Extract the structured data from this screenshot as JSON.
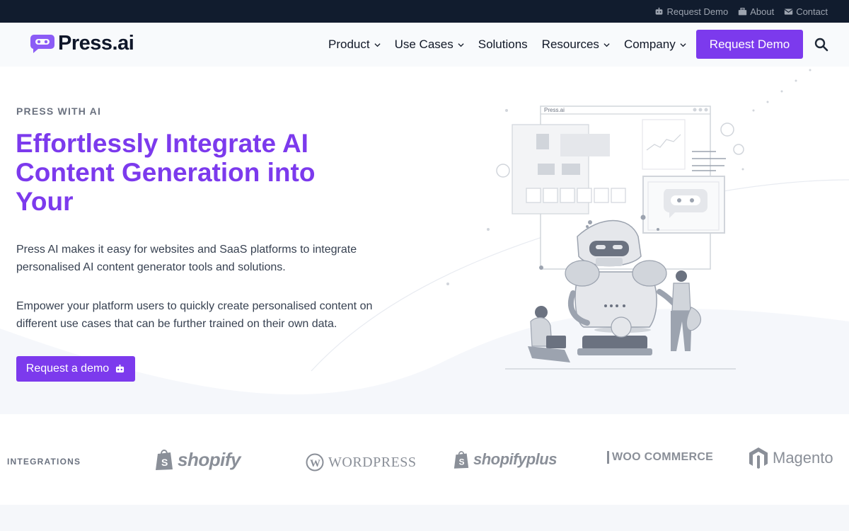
{
  "topbar": {
    "links": [
      {
        "label": "Request Demo",
        "icon": "robot-icon"
      },
      {
        "label": "About",
        "icon": "briefcase-icon"
      },
      {
        "label": "Contact",
        "icon": "envelope-icon"
      }
    ]
  },
  "header": {
    "logo_text": "Press.ai",
    "nav": [
      {
        "label": "Product",
        "has_dropdown": true
      },
      {
        "label": "Use Cases",
        "has_dropdown": true
      },
      {
        "label": "Solutions",
        "has_dropdown": false
      },
      {
        "label": "Resources",
        "has_dropdown": true
      },
      {
        "label": "Company",
        "has_dropdown": true
      }
    ],
    "cta_label": "Request Demo"
  },
  "hero": {
    "eyebrow": "PRESS WITH AI",
    "headline": "Effortlessly Integrate AI Content Generation into Your",
    "paragraph1": "Press AI makes it easy for websites and SaaS platforms to integrate personalised AI content generator tools and solutions.",
    "paragraph2": "Empower your platform users to quickly create personalised content on different use cases that can be further trained on their own data.",
    "cta_label": "Request a demo",
    "illustration_window_title": "Press.ai"
  },
  "integrations": {
    "label": "INTEGRATIONS",
    "brands": [
      "shopify",
      "WordPress",
      "shopifyplus",
      "WOO COMMERCE",
      "Magento"
    ]
  },
  "colors": {
    "brand_purple": "#7c3aed",
    "topbar_bg": "#111c2e",
    "header_bg": "#f8fafc",
    "logo_icon": "#8b5cf6"
  }
}
